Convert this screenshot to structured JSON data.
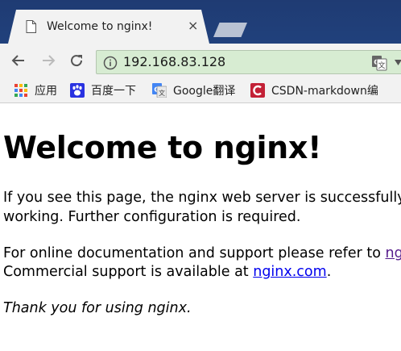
{
  "tab": {
    "title": "Welcome to nginx!",
    "close_glyph": "×",
    "favicon": "page-icon"
  },
  "toolbar": {
    "back_icon": "back-arrow-icon",
    "forward_icon": "forward-arrow-icon",
    "reload_icon": "reload-icon",
    "url": "192.168.83.128",
    "omnibox_color": "#d7ecd2"
  },
  "bookmarks": [
    {
      "label": "应用",
      "icon": "apps-grid-icon"
    },
    {
      "label": "百度一下",
      "icon": "baidu-paw-icon"
    },
    {
      "label": "Google翻译",
      "icon": "google-translate-icon"
    },
    {
      "label": "CSDN-markdown编",
      "icon": "csdn-icon"
    }
  ],
  "page": {
    "heading": "Welcome to nginx!",
    "para1_line1": "If you see this page, the nginx web server is successfully",
    "para1_line2": "working. Further configuration is required.",
    "para2_line1_prefix": "For online documentation and support please refer to ",
    "para2_link1": "nginx.org",
    "para2_line2_prefix": "Commercial support is available at ",
    "para2_link2": "nginx.com",
    "para2_line2_suffix": ".",
    "para3": "Thank you for using nginx."
  },
  "colors": {
    "titlebar": "#20417c",
    "chrome": "#f2f2f2",
    "link": "#0000ee",
    "visited_link": "#551a8b"
  }
}
